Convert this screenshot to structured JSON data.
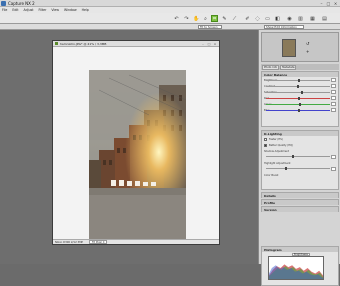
{
  "window": {
    "title": "Capture NX 2"
  },
  "menu": [
    "File",
    "Edit",
    "Adjust",
    "Filter",
    "View",
    "Window",
    "Help"
  ],
  "toolbar": {
    "icons": [
      "rotate-ccw-icon",
      "rotate-cw-icon",
      "hand-icon",
      "zoom-icon",
      "crop-icon",
      "color-picker-icon",
      "straighten-icon",
      "brush-icon",
      "lasso-icon",
      "selection-icon",
      "gradient-icon",
      "fill-icon"
    ]
  },
  "toolbar2": {
    "zoom_select": "Fit to Screen",
    "mode_select": "Show Edit Information"
  },
  "image_window": {
    "title": "hamnlohn.JPG* @ 41% / 3,3MB",
    "status_left": "Nikon D300 2/12 3MP",
    "status_zoom": "Fit Pixel X"
  },
  "panel": {
    "tabs": [
      "Photo Info",
      "Metadata"
    ],
    "sections": [
      {
        "title": "Color Balance",
        "rows": [
          "Brightness",
          "Contrast",
          "Saturation",
          "Red",
          "Green",
          "Blue"
        ]
      },
      {
        "title": "D-Lighting",
        "rows": [
          "Faster (HS)",
          "Better Quality (HQ)",
          "Shadow Adjustment",
          "Highlight Adjustment",
          "Color Boost"
        ]
      },
      {
        "title": "Details",
        "rows": []
      },
      {
        "title": "Profile",
        "rows": []
      },
      {
        "title": "Version",
        "rows": []
      }
    ],
    "histogram_title": "Histogram",
    "histogram_channel": "Brightness"
  }
}
